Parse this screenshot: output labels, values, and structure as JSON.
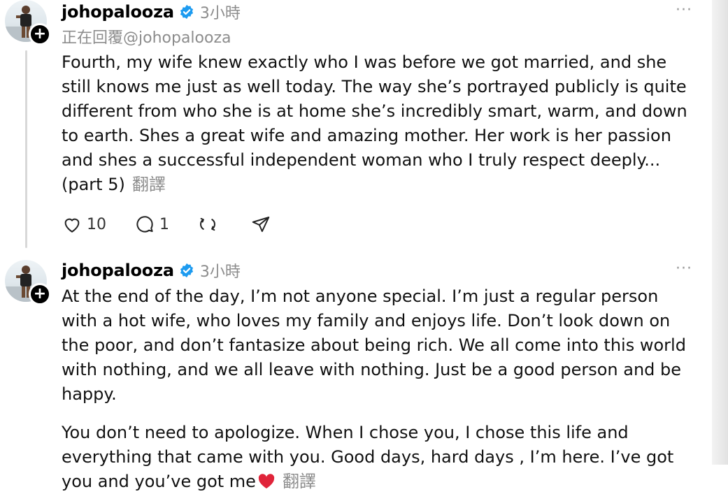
{
  "posts": [
    {
      "username": "johopalooza",
      "time": "3小時",
      "replying_to": "正在回覆@johopalooza",
      "text": "Fourth, my wife knew exactly who I was before we got married, and she still knows me just as well today. The way she’s portrayed publicly is quite different from who she is at home she’s incredibly smart, warm, and down to earth. Shes a great wife and amazing mother. Her work is her passion and shes a successful independent woman who I truly respect deeply... (part 5)",
      "translate_label": "翻譯",
      "likes": "10",
      "replies": "1"
    },
    {
      "username": "johopalooza",
      "time": "3小時",
      "paragraph1": "At the end of the day, I’m not anyone special. I’m just a regular person with a hot wife, who loves my family and enjoys life. Don’t look down on the poor, and don’t fantasize about being rich. We all come into this world with nothing, and we all leave with nothing. Just be a good person and be happy.",
      "paragraph2": "You don’t need to apologize. When I chose you, I chose this life and everything that came with you. Good days, hard days , I’m here. I’ve got you and you’ve got me",
      "translate_label": "翻譯"
    }
  ],
  "more_label": "···",
  "icons": {
    "verified": "verified-badge-icon",
    "like": "heart-outline-icon",
    "reply": "comment-bubble-icon",
    "repost": "repost-arrows-icon",
    "share": "send-paper-plane-icon",
    "follow": "plus-icon",
    "emoji": "red-heart-emoji"
  },
  "colors": {
    "verified": "#1d9bf0",
    "muted": "#8c8c8c",
    "heart": "#e0243a"
  }
}
